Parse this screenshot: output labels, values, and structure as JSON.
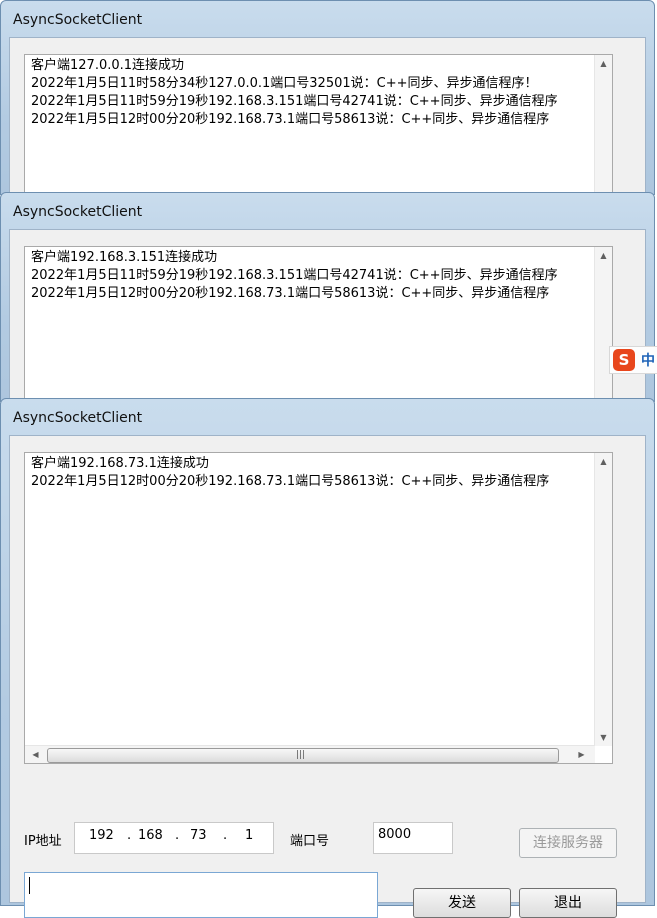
{
  "windows": [
    {
      "title": "AsyncSocketClient",
      "lines": [
        "客户端127.0.0.1连接成功",
        "2022年1月5日11时58分34秒127.0.0.1端口号32501说：C++同步、异步通信程序！",
        "2022年1月5日11时59分19秒192.168.3.151端口号42741说：C++同步、异步通信程序",
        "2022年1月5日12时00分20秒192.168.73.1端口号58613说：C++同步、异步通信程序"
      ]
    },
    {
      "title": "AsyncSocketClient",
      "lines": [
        "客户端192.168.3.151连接成功",
        "2022年1月5日11时59分19秒192.168.3.151端口号42741说：C++同步、异步通信程序",
        "2022年1月5日12时00分20秒192.168.73.1端口号58613说：C++同步、异步通信程序"
      ]
    },
    {
      "title": "AsyncSocketClient",
      "lines": [
        "客户端192.168.73.1连接成功",
        "2022年1月5日12时00分20秒192.168.73.1端口号58613说：C++同步、异步通信程序"
      ]
    }
  ],
  "scroll": {
    "grip": "|||"
  },
  "form": {
    "ip_label": "IP地址",
    "ip_octets": [
      "192",
      "168",
      "73",
      "1"
    ],
    "ip_dots": [
      ".",
      ".",
      "."
    ],
    "port_label": "端口号",
    "port_value": "8000",
    "connect_button": "连接服务器",
    "message_value": "",
    "send_button": "发送",
    "exit_button": "退出"
  },
  "ime": {
    "logo": "S",
    "mode": "中"
  }
}
